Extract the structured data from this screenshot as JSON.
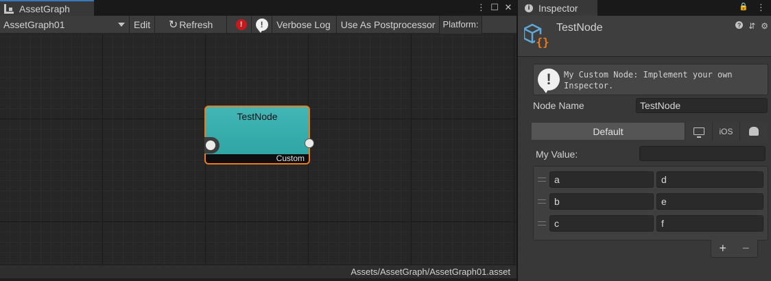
{
  "graph_window": {
    "tab_title": "AssetGraph",
    "controls": [
      "⋮",
      "☐",
      "✕"
    ],
    "toolbar": {
      "graph_selector": "AssetGraph01",
      "edit_label": "Edit",
      "refresh_label": "Refresh",
      "error_badge": "!",
      "info_badge": "!",
      "verbose_log_label": "Verbose Log",
      "postprocessor_label": "Use As Postprocessor",
      "platform_label": "Platform:"
    },
    "node": {
      "title": "TestNode",
      "footer": "Custom",
      "border_color": "#f07a1a",
      "fill_color": "#3aaeae"
    },
    "status_path": "Assets/AssetGraph/AssetGraph01.asset"
  },
  "inspector": {
    "tab_title": "Inspector",
    "tab_info": "i",
    "controls": [
      "🔒",
      "⋮"
    ],
    "header_title": "TestNode",
    "header_icons": [
      "?",
      "⇵",
      "⚙"
    ],
    "help_text": "My Custom Node: Implement your own Inspector.",
    "help_badge": "!",
    "node_name_label": "Node Name",
    "node_name_value": "TestNode",
    "platform_tabs": {
      "default": "Default",
      "ios": "iOS"
    },
    "my_value_label": "My Value:",
    "my_value_value": "",
    "list_rows": [
      {
        "left": "a",
        "right": "d"
      },
      {
        "left": "b",
        "right": "e"
      },
      {
        "left": "c",
        "right": "f"
      }
    ],
    "add_button": "+",
    "remove_button": "−"
  }
}
